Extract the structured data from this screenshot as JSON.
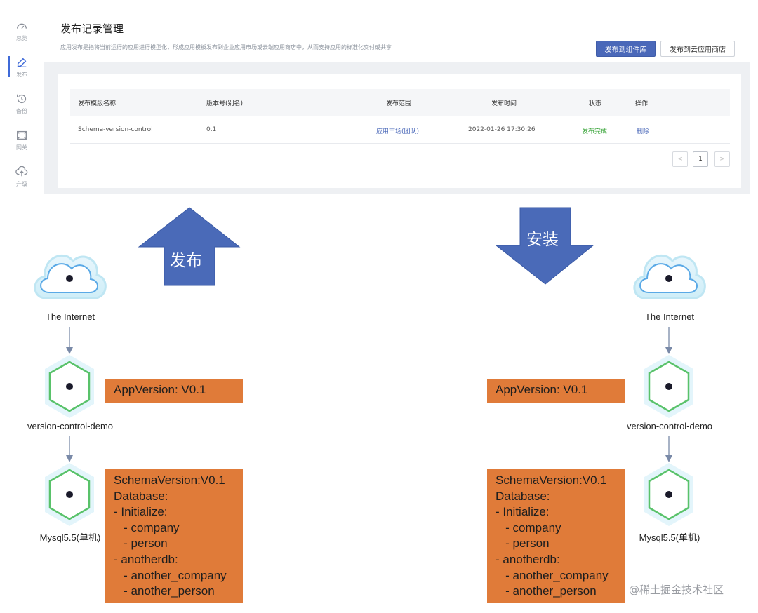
{
  "sidebar": {
    "items": [
      {
        "label": "总览",
        "icon": "dashboard-icon"
      },
      {
        "label": "发布",
        "icon": "publish-icon"
      },
      {
        "label": "备份",
        "icon": "backup-icon"
      },
      {
        "label": "网关",
        "icon": "gateway-icon"
      },
      {
        "label": "升级",
        "icon": "upgrade-icon"
      }
    ]
  },
  "header": {
    "title": "发布记录管理",
    "description": "应用发布是指将当前运行的应用进行模型化，形成应用模板发布到企业应用市场或云端应用商店中，从而支持应用的标准化交付或共享",
    "publish_component_button": "发布到组件库",
    "publish_cloud_button": "发布到云应用商店"
  },
  "table": {
    "columns": [
      "发布模版名称",
      "版本号(别名)",
      "发布范围",
      "发布时间",
      "状态",
      "操作"
    ],
    "rows": [
      {
        "name": "Schema-version-control",
        "version": "0.1",
        "scope": "应用市场(团队)",
        "time": "2022-01-26 17:30:26",
        "status": "发布完成",
        "action": "删除"
      }
    ],
    "pagination": {
      "prev": "<",
      "current": "1",
      "next": ">"
    }
  },
  "arrows": {
    "publish": "发布",
    "install": "安装"
  },
  "left_diagram": {
    "internet": "The Internet",
    "app": "version-control-demo",
    "db": "Mysql5.5(单机)",
    "app_version": "AppVersion: V0.1",
    "schema_lines": [
      "SchemaVersion:V0.1",
      "Database:",
      "- Initialize:",
      "   - company",
      "   - person",
      "- anotherdb:",
      "   - another_company",
      "   - another_person"
    ]
  },
  "right_diagram": {
    "internet": "The Internet",
    "app": "version-control-demo",
    "db": "Mysql5.5(单机)",
    "app_version": "AppVersion: V0.1",
    "schema_lines": [
      "SchemaVersion:V0.1",
      "Database:",
      "- Initialize:",
      "   - company",
      "   - person",
      "- anotherdb:",
      "   - another_company",
      "   - another_person"
    ]
  },
  "watermark": "@稀土掘金技术社区",
  "colors": {
    "accent": "#4a68b9",
    "arrow": "#4a6ab8",
    "orange": "#e07b39",
    "success": "#3aa53a",
    "hex_green": "#59c26a"
  }
}
